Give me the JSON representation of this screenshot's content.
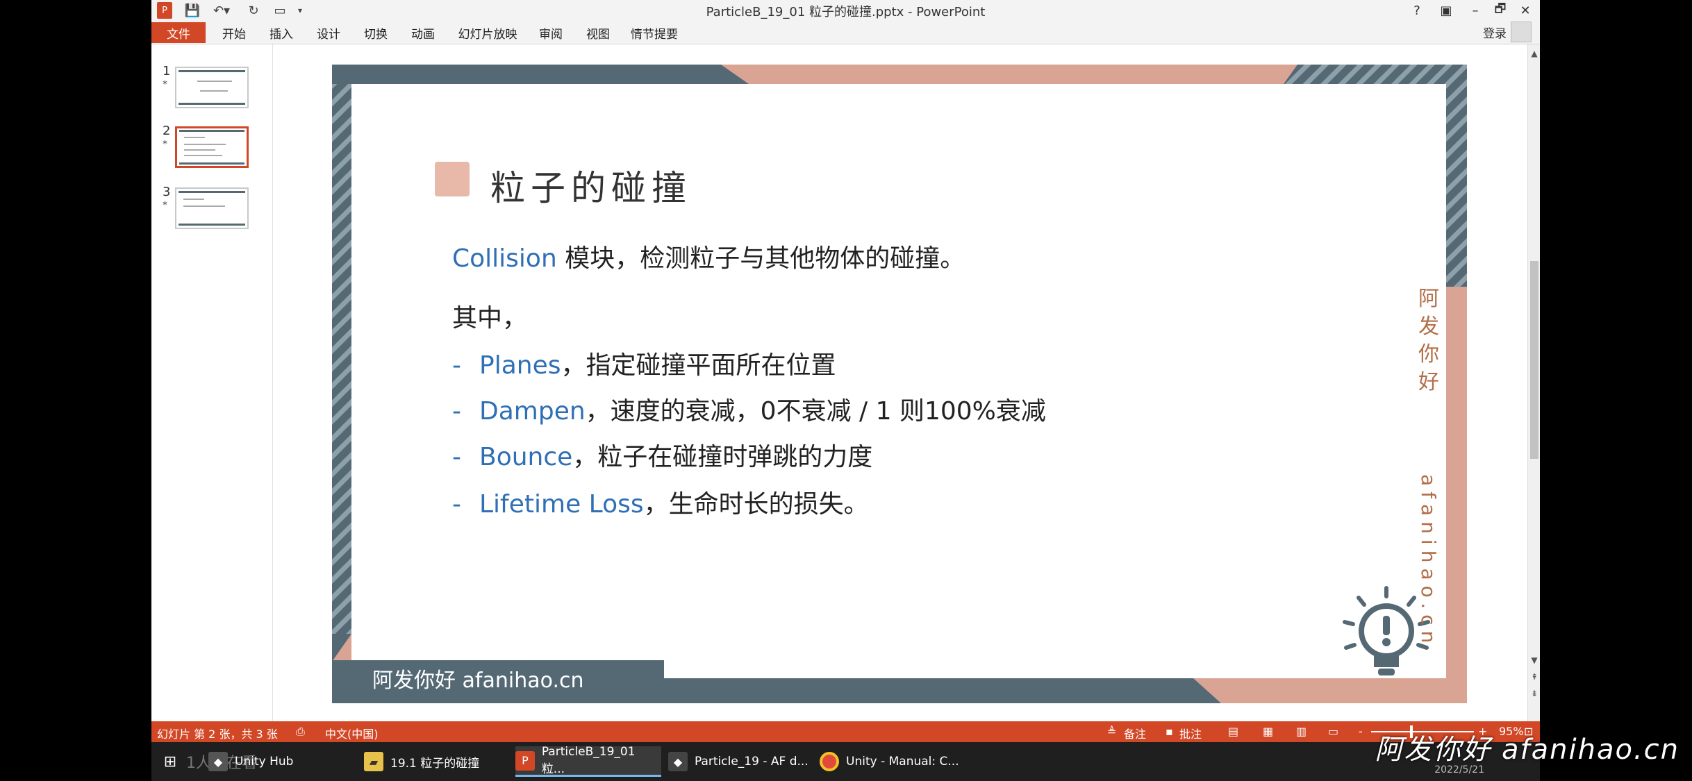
{
  "window": {
    "title": "ParticleB_19_01 粒子的碰撞.pptx - PowerPoint",
    "help": "?",
    "ribbon_display": "▣",
    "minimize": "–",
    "restore": "🗗",
    "close": "✕"
  },
  "ribbon": {
    "tabs": [
      "文件",
      "开始",
      "插入",
      "设计",
      "切换",
      "动画",
      "幻灯片放映",
      "审阅",
      "视图",
      "情节提要"
    ],
    "login": "登录"
  },
  "thumbnails": [
    {
      "num": "1",
      "star": "*"
    },
    {
      "num": "2",
      "star": "*"
    },
    {
      "num": "3",
      "star": "*"
    }
  ],
  "slide": {
    "title": "粒子的碰撞",
    "intro_kw": "Collision",
    "intro_rest": " 模块，检测粒子与其他物体的碰撞。",
    "subhead": "其中，",
    "bullets": [
      {
        "dash": "-",
        "kw": "Planes",
        "text": "，指定碰撞平面所在位置"
      },
      {
        "dash": "-",
        "kw": "Dampen",
        "text": "，速度的衰减，0不衰减 / 1 则100%衰减"
      },
      {
        "dash": "-",
        "kw": "Bounce",
        "text": "，粒子在碰撞时弹跳的力度"
      },
      {
        "dash": "-",
        "kw": "Lifetime Loss",
        "text": "，生命时长的损失。"
      }
    ],
    "side_mark": "阿发你好",
    "side_url": "afanihao.cn",
    "footer": "阿发你好 afanihao.cn"
  },
  "statusbar": {
    "slide_info": "幻灯片 第 2 张，共 3 张",
    "language": "中文(中国)",
    "notes": "备注",
    "comments": "批注",
    "zoom": "95%",
    "zoom_minus": "-",
    "zoom_plus": "+"
  },
  "taskbar": {
    "items": [
      {
        "label": "Unity Hub"
      },
      {
        "label": "19.1 粒子的碰撞"
      },
      {
        "label": "ParticleB_19_01 粒..."
      },
      {
        "label": "Particle_19 - AF d..."
      },
      {
        "label": "Unity - Manual: C..."
      }
    ],
    "behind_text": "1人正在看",
    "date": "2022/5/21"
  },
  "watermark": "阿发你好 afanihao.cn",
  "colors": {
    "accent": "#d24726",
    "keyword_blue": "#2f6fb5",
    "slide_frame_slate": "#556975",
    "slide_frame_peach": "#d9a493"
  }
}
